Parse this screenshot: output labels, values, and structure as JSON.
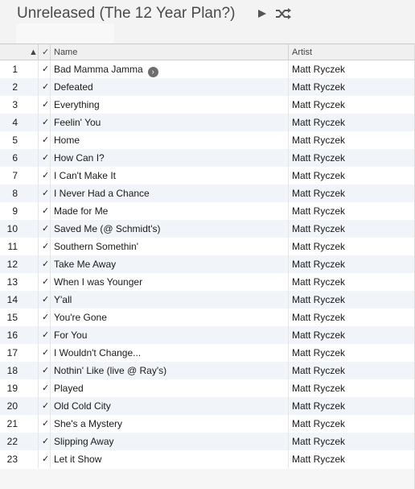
{
  "playlist": {
    "title": "Unreleased (The 12 Year Plan?)",
    "play_icon": "play-icon",
    "shuffle_icon": "shuffle-icon"
  },
  "columns": {
    "sort_indicator": "▲",
    "check_header": "✓",
    "name": "Name",
    "artist": "Artist"
  },
  "check_glyph": "✓",
  "colors": {
    "row_alt": "#f1f4f8",
    "header_bg": "#f3f3f3"
  },
  "tracks": [
    {
      "num": "1",
      "name": "Bad Mamma Jamma",
      "artist": "Matt Ryczek"
    },
    {
      "num": "2",
      "name": "Defeated",
      "artist": "Matt Ryczek"
    },
    {
      "num": "3",
      "name": "Everything",
      "artist": "Matt Ryczek"
    },
    {
      "num": "4",
      "name": "Feelin' You",
      "artist": "Matt Ryczek"
    },
    {
      "num": "5",
      "name": "Home",
      "artist": "Matt Ryczek"
    },
    {
      "num": "6",
      "name": "How Can I?",
      "artist": "Matt Ryczek"
    },
    {
      "num": "7",
      "name": "I Can't Make It",
      "artist": "Matt Ryczek"
    },
    {
      "num": "8",
      "name": "I Never Had a Chance",
      "artist": "Matt Ryczek"
    },
    {
      "num": "9",
      "name": "Made for Me",
      "artist": "Matt Ryczek"
    },
    {
      "num": "10",
      "name": "Saved Me (@ Schmidt's)",
      "artist": "Matt Ryczek"
    },
    {
      "num": "11",
      "name": "Southern Somethin'",
      "artist": "Matt Ryczek"
    },
    {
      "num": "12",
      "name": "Take Me Away",
      "artist": "Matt Ryczek"
    },
    {
      "num": "13",
      "name": "When I was Younger",
      "artist": "Matt Ryczek"
    },
    {
      "num": "14",
      "name": "Y'all",
      "artist": "Matt Ryczek"
    },
    {
      "num": "15",
      "name": "You're Gone",
      "artist": "Matt Ryczek"
    },
    {
      "num": "16",
      "name": "For You",
      "artist": "Matt Ryczek"
    },
    {
      "num": "17",
      "name": "I Wouldn't Change...",
      "artist": "Matt Ryczek"
    },
    {
      "num": "18",
      "name": "Nothin' Like (live @ Ray's)",
      "artist": "Matt Ryczek"
    },
    {
      "num": "19",
      "name": "Played",
      "artist": "Matt Ryczek"
    },
    {
      "num": "20",
      "name": "Old Cold City",
      "artist": "Matt Ryczek"
    },
    {
      "num": "21",
      "name": "She's a Mystery",
      "artist": "Matt Ryczek"
    },
    {
      "num": "22",
      "name": "Slipping Away",
      "artist": "Matt Ryczek"
    },
    {
      "num": "23",
      "name": "Let it Show",
      "artist": "Matt Ryczek"
    }
  ]
}
